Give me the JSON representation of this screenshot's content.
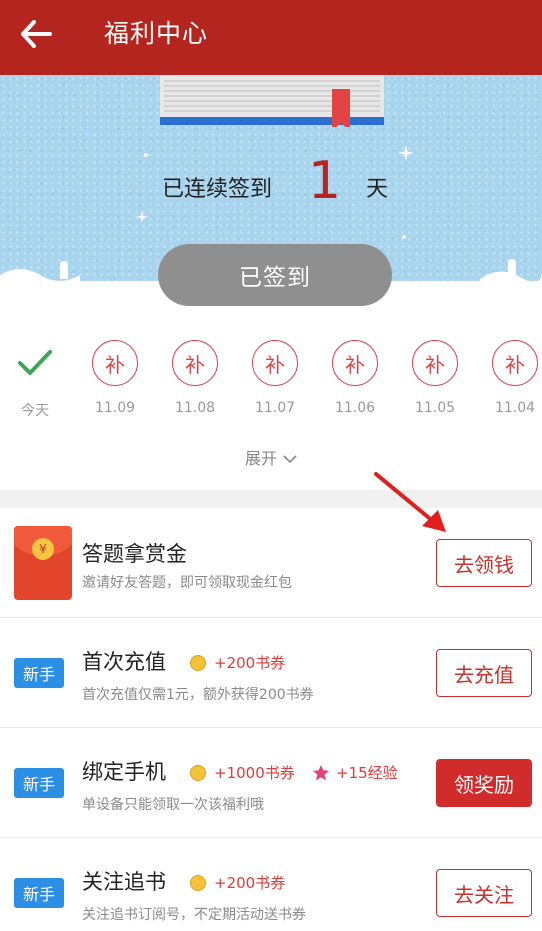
{
  "header": {
    "title": "福利中心",
    "back_icon": "arrow-left-icon"
  },
  "checkin": {
    "prefix": "已连续签到",
    "days": "1",
    "suffix": "天",
    "button_label": "已签到"
  },
  "days": [
    {
      "mark": "check",
      "label": "今天"
    },
    {
      "mark": "补",
      "label": "11.09"
    },
    {
      "mark": "补",
      "label": "11.08"
    },
    {
      "mark": "补",
      "label": "11.07"
    },
    {
      "mark": "补",
      "label": "11.06"
    },
    {
      "mark": "补",
      "label": "11.05"
    },
    {
      "mark": "补",
      "label": "11.04"
    }
  ],
  "expand_label": "展开",
  "tasks": [
    {
      "name": "答题拿赏金",
      "desc": "邀请好友答题，即可领取现金红包",
      "action": "去领钱",
      "icon": "red-packet-icon"
    },
    {
      "badge": "新手",
      "name": "首次充值",
      "reward1": "+200书券",
      "desc": "首次充值仅需1元，额外获得200书券",
      "action": "去充值"
    },
    {
      "badge": "新手",
      "name": "绑定手机",
      "reward1": "+1000书券",
      "reward2": "+15经验",
      "desc": "单设备只能领取一次该福利哦",
      "action": "领奖励"
    },
    {
      "badge": "新手",
      "name": "关注追书",
      "reward1": "+200书券",
      "desc": "关注追书订阅号，不定期活动送书券",
      "action": "去关注"
    }
  ],
  "colors": {
    "header": "#b5251f",
    "accent": "#d12b2b",
    "hero": "#a9d4ee",
    "badge": "#2b8fe5"
  }
}
